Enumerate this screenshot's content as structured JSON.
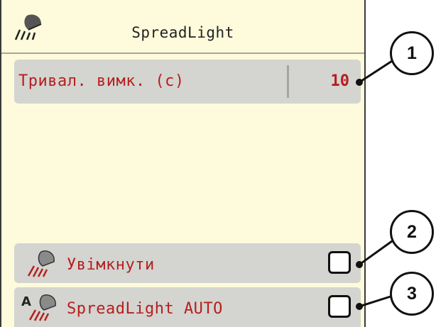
{
  "header": {
    "title": "SpreadLight",
    "icon": "spreadlight-lamp-icon"
  },
  "rows": [
    {
      "label": "Тривал. вимк. (с)",
      "value": "10"
    },
    {
      "label": "Увімкнути",
      "checked": false,
      "icon": "spreadlight-lamp-icon"
    },
    {
      "label": "SpreadLight AUTO",
      "checked": false,
      "icon": "spreadlight-auto-icon",
      "icon_letter": "A"
    }
  ],
  "callouts": [
    "1",
    "2",
    "3"
  ],
  "colors": {
    "screen_bg": "#fdfbdc",
    "row_bg": "#d4d4d0",
    "label_red": "#b51f1f"
  }
}
